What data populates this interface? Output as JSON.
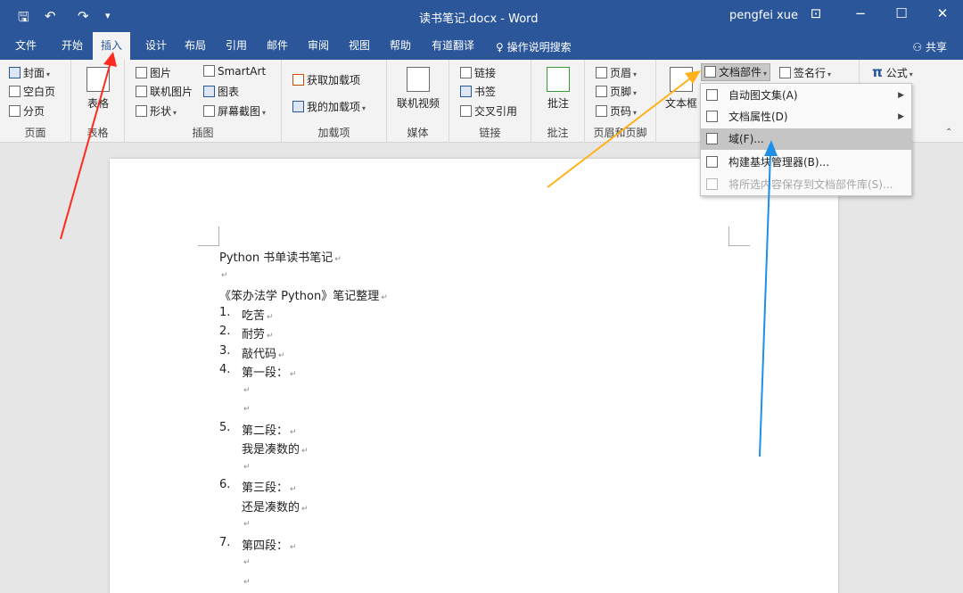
{
  "window": {
    "title": "读书笔记.docx - Word",
    "user": "pengfei xue",
    "quick_access": [
      "save-icon",
      "undo-icon",
      "redo-icon",
      "customize-icon"
    ],
    "controls": [
      "ribbon-display-icon",
      "minimize-icon",
      "maximize-icon",
      "close-icon"
    ]
  },
  "tabs": {
    "file": "文件",
    "home": "开始",
    "insert": "插入",
    "design": "设计",
    "layout": "布局",
    "references": "引用",
    "mailings": "邮件",
    "review": "审阅",
    "view": "视图",
    "help": "帮助",
    "translate": "有道翻译",
    "tellme": "操作说明搜索",
    "share": "共享",
    "active": "插入"
  },
  "ribbon": {
    "pages": {
      "cover": "封面",
      "blank": "空白页",
      "break": "分页",
      "label": "页面"
    },
    "tables": {
      "table": "表格",
      "label": "表格"
    },
    "illustrations": {
      "pictures": "图片",
      "online_pictures": "联机图片",
      "shapes": "形状",
      "smartart": "SmartArt",
      "chart": "图表",
      "screenshot": "屏幕截图",
      "label": "插图"
    },
    "addins": {
      "get": "获取加载项",
      "my": "我的加载项",
      "label": "加载项"
    },
    "media": {
      "online_video": "联机视频",
      "label": "媒体"
    },
    "links": {
      "link": "链接",
      "bookmark": "书签",
      "crossref": "交叉引用",
      "label": "链接"
    },
    "comments": {
      "comment": "批注",
      "label": "批注"
    },
    "header_footer": {
      "header": "页眉",
      "footer": "页脚",
      "page_number": "页码",
      "label": "页眉和页脚"
    },
    "text": {
      "textbox": "文本框",
      "quick_parts": "文档部件",
      "signature": "签名行"
    },
    "symbols": {
      "equation": "公式"
    }
  },
  "menu": {
    "items": [
      {
        "label": "自动图文集(A)",
        "icon": "autotext-icon",
        "submenu": true,
        "state": "normal"
      },
      {
        "label": "文档属性(D)",
        "icon": "document-property-icon",
        "submenu": true,
        "state": "normal"
      },
      {
        "label": "域(F)...",
        "icon": "field-icon",
        "submenu": false,
        "state": "highlighted"
      },
      {
        "label": "构建基块管理器(B)...",
        "icon": "building-blocks-icon",
        "submenu": false,
        "state": "normal"
      },
      {
        "label": "将所选内容保存到文档部件库(S)...",
        "icon": "save-selection-icon",
        "submenu": false,
        "state": "disabled"
      }
    ]
  },
  "document": {
    "lines": [
      {
        "text": "Python 书单读书笔记"
      },
      {
        "text": ""
      },
      {
        "text": "《笨办法学 Python》笔记整理"
      },
      {
        "num": "1.",
        "text": "吃苦"
      },
      {
        "num": "2.",
        "text": "耐劳"
      },
      {
        "num": "3.",
        "text": "敲代码"
      },
      {
        "num": "4.",
        "text": "第一段："
      },
      {
        "text": ""
      },
      {
        "text": ""
      },
      {
        "num": "5.",
        "text": "第二段："
      },
      {
        "text": "我是凑数的"
      },
      {
        "text": ""
      },
      {
        "num": "6.",
        "text": "第三段："
      },
      {
        "text": "还是凑数的"
      },
      {
        "text": ""
      },
      {
        "num": "7.",
        "text": "第四段："
      },
      {
        "text": ""
      },
      {
        "text": ""
      }
    ],
    "paragraph_mark": "↵"
  },
  "colors": {
    "titlebar": "#2b579a",
    "ribbon": "#f3f3f3",
    "arrow_red": "#ff2a1f",
    "arrow_orange": "#ffb21a",
    "arrow_blue": "#1e8fe8"
  }
}
